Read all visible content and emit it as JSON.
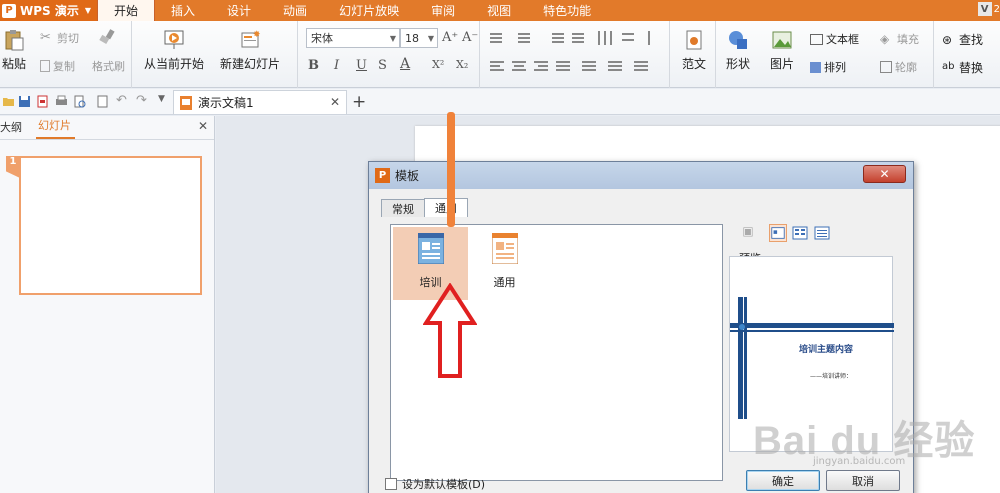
{
  "app": {
    "name": "WPS 演示",
    "logo_letter": "P"
  },
  "menu": {
    "tabs": [
      {
        "label": "开始",
        "active": true
      },
      {
        "label": "插入"
      },
      {
        "label": "设计"
      },
      {
        "label": "动画"
      },
      {
        "label": "幻灯片放映"
      },
      {
        "label": "审阅"
      },
      {
        "label": "视图"
      },
      {
        "label": "特色功能"
      }
    ],
    "user_badge": "V",
    "user_text": "2"
  },
  "ribbon": {
    "paste": "粘贴",
    "cut": "剪切",
    "copy": "复制",
    "format_painter": "格式刷",
    "from_current": "从当前开始",
    "new_slide": "新建幻灯片",
    "font_name": "宋体",
    "font_size": "18",
    "bold": "B",
    "italic": "I",
    "underline": "U",
    "strikethrough": "S",
    "font_color": "A",
    "superscript": "X²",
    "subscript": "X₂",
    "grow_font": "A⁺",
    "shrink_font": "A⁻",
    "sample": "范文",
    "shape": "形状",
    "picture": "图片",
    "textbox": "文本框",
    "arrange": "排列",
    "fill": "填充",
    "outline": "轮廓",
    "find": "查找",
    "replace": "替换"
  },
  "doc_tab": {
    "title": "演示文稿1"
  },
  "left_panel": {
    "tab_outline": "大纲",
    "tab_slides": "幻灯片",
    "slide_number": "1"
  },
  "dialog": {
    "title": "模板",
    "logo_letter": "P",
    "tabs": [
      {
        "label": "常规"
      },
      {
        "label": "通用",
        "active": true
      }
    ],
    "templates": [
      {
        "label": "培训",
        "selected": true
      },
      {
        "label": "通用"
      }
    ],
    "preview_label": "预览",
    "preview_title": "培训主题内容",
    "preview_subtitle": "——培训讲师：",
    "set_default": "设为默认模板(D)",
    "set_default_checked": false,
    "ok": "确定",
    "cancel": "取消",
    "close": "✕"
  },
  "watermark": {
    "text": "Bai du 经验",
    "url": "jingyan.baidu.com"
  },
  "colors": {
    "accent_orange": "#e27a2a",
    "selection": "#f3cdb5",
    "arrow_red": "#e02020",
    "preview_blue": "#2b4d8a"
  }
}
